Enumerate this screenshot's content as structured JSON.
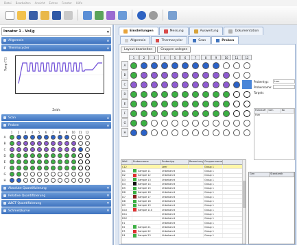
{
  "menubar": [
    "Datei",
    "Bearbeiten",
    "Ansicht",
    "Extras",
    "Fenster",
    "Hilfe"
  ],
  "left": {
    "combo_value": "Innator 1 - Vol/g",
    "sections": {
      "allgemein": "Allgemein",
      "thermo": "Thermocycler",
      "scan": "Scan",
      "proben": "Proben"
    },
    "thermo_chart": {
      "ylabel": "Temp (°C)",
      "xlabel": "Zeit/s"
    },
    "plate_cols": [
      "1",
      "2",
      "3",
      "4",
      "5",
      "6",
      "7",
      "8",
      "9",
      "10",
      "11",
      "12"
    ],
    "bottom_sections": [
      "Absolute Quantifizierung",
      "Relative Quantifizierung",
      "ΔΔCT Quantifizierung",
      "Schmelzkurve"
    ]
  },
  "main": {
    "tabs": [
      "Einstellungen",
      "Messung",
      "Auswertung",
      "Dokumentation"
    ],
    "subtabs": [
      "Allgemein",
      "Thermocycler",
      "Scan",
      "Proben"
    ],
    "buttons": [
      "Layout bearbeiten",
      "Gruppen anlegen"
    ],
    "plate_cols": [
      "1",
      "2",
      "3",
      "4",
      "5",
      "6",
      "7",
      "8",
      "9",
      "10",
      "11",
      "12"
    ],
    "plate_rows": [
      "A",
      "B",
      "C",
      "D",
      "E",
      "F",
      "G",
      "H"
    ],
    "props": [
      {
        "label": "Probentyp:",
        "value": "Leer"
      },
      {
        "label": "Probenname:",
        "value": ""
      },
      {
        "label": "Targets",
        "value": ""
      }
    ],
    "grid2_headers": [
      "Farbstoff",
      "Gen",
      "Ko"
    ],
    "grid2_rows": [
      "Fam"
    ],
    "table_headers": [
      "Well",
      "Probenname",
      "Probentyp",
      "Bemerkung",
      "Gruppenname"
    ],
    "table_rows": [
      {
        "well": "C12",
        "name": "",
        "type": "Leer",
        "note": "",
        "group": "Group 1",
        "color": "",
        "selected": true
      },
      {
        "well": "D1",
        "name": "Sample 11",
        "type": "Unbekannt",
        "note": "",
        "group": "Group 1",
        "color": "#3cb043"
      },
      {
        "well": "D2",
        "name": "Sample 12",
        "type": "Unbekannt",
        "note": "",
        "group": "Group 1",
        "color": "#e03030"
      },
      {
        "well": "D3",
        "name": "Sample 13",
        "type": "Unbekannt",
        "note": "",
        "group": "Group 1",
        "color": "#3cb043"
      },
      {
        "well": "D4",
        "name": "Sample 14",
        "type": "Unbekannt",
        "note": "",
        "group": "Group 1",
        "color": "#111111"
      },
      {
        "well": "D5",
        "name": "Sample 15",
        "type": "Unbekannt",
        "note": "",
        "group": "Group 1",
        "color": "#3cb043"
      },
      {
        "well": "D6",
        "name": "Sample 16",
        "type": "Unbekannt",
        "note": "",
        "group": "Group 1",
        "color": "#3cb043"
      },
      {
        "well": "D7",
        "name": "Sample 17",
        "type": "Unbekannt",
        "note": "",
        "group": "Group 1",
        "color": "#8a1f1f"
      },
      {
        "well": "D8",
        "name": "Sample 18",
        "type": "Unbekannt",
        "note": "",
        "group": "Group 1",
        "color": "#3cb043"
      },
      {
        "well": "D9",
        "name": "Sample 19",
        "type": "Unbekannt",
        "note": "",
        "group": "Group 1",
        "color": "#3cb043"
      },
      {
        "well": "D10",
        "name": "Sample 110",
        "type": "Unbekannt",
        "note": "",
        "group": "Group 1",
        "color": "#e03030"
      },
      {
        "well": "D11",
        "name": "",
        "type": "Unbekannt",
        "note": "",
        "group": "Group 1",
        "color": ""
      },
      {
        "well": "D12",
        "name": "",
        "type": "Unbekannt",
        "note": "",
        "group": "Group 1",
        "color": ""
      },
      {
        "well": "E1",
        "name": "",
        "type": "Unbekannt",
        "note": "",
        "group": "Group 1",
        "color": ""
      },
      {
        "well": "E2",
        "name": "Sample 21",
        "type": "Unbekannt",
        "note": "",
        "group": "Group 1",
        "color": "#3cb043"
      },
      {
        "well": "E3",
        "name": "Sample 22",
        "type": "Unbekannt",
        "note": "",
        "group": "Group 1",
        "color": "#e03030"
      },
      {
        "well": "E4",
        "name": "Sample 23",
        "type": "Unbekannt",
        "note": "",
        "group": "Group 1",
        "color": "#3cb043"
      }
    ],
    "table2_headers": [
      "Gen",
      "Standardk"
    ],
    "colors": {
      "accent": "#3f73bf",
      "selected_row": "#fff6a8",
      "well_green": "#3cb043",
      "well_blue": "#2b62c7",
      "well_purple": "#8e5bd0",
      "well_empty": "#ffffff"
    }
  }
}
